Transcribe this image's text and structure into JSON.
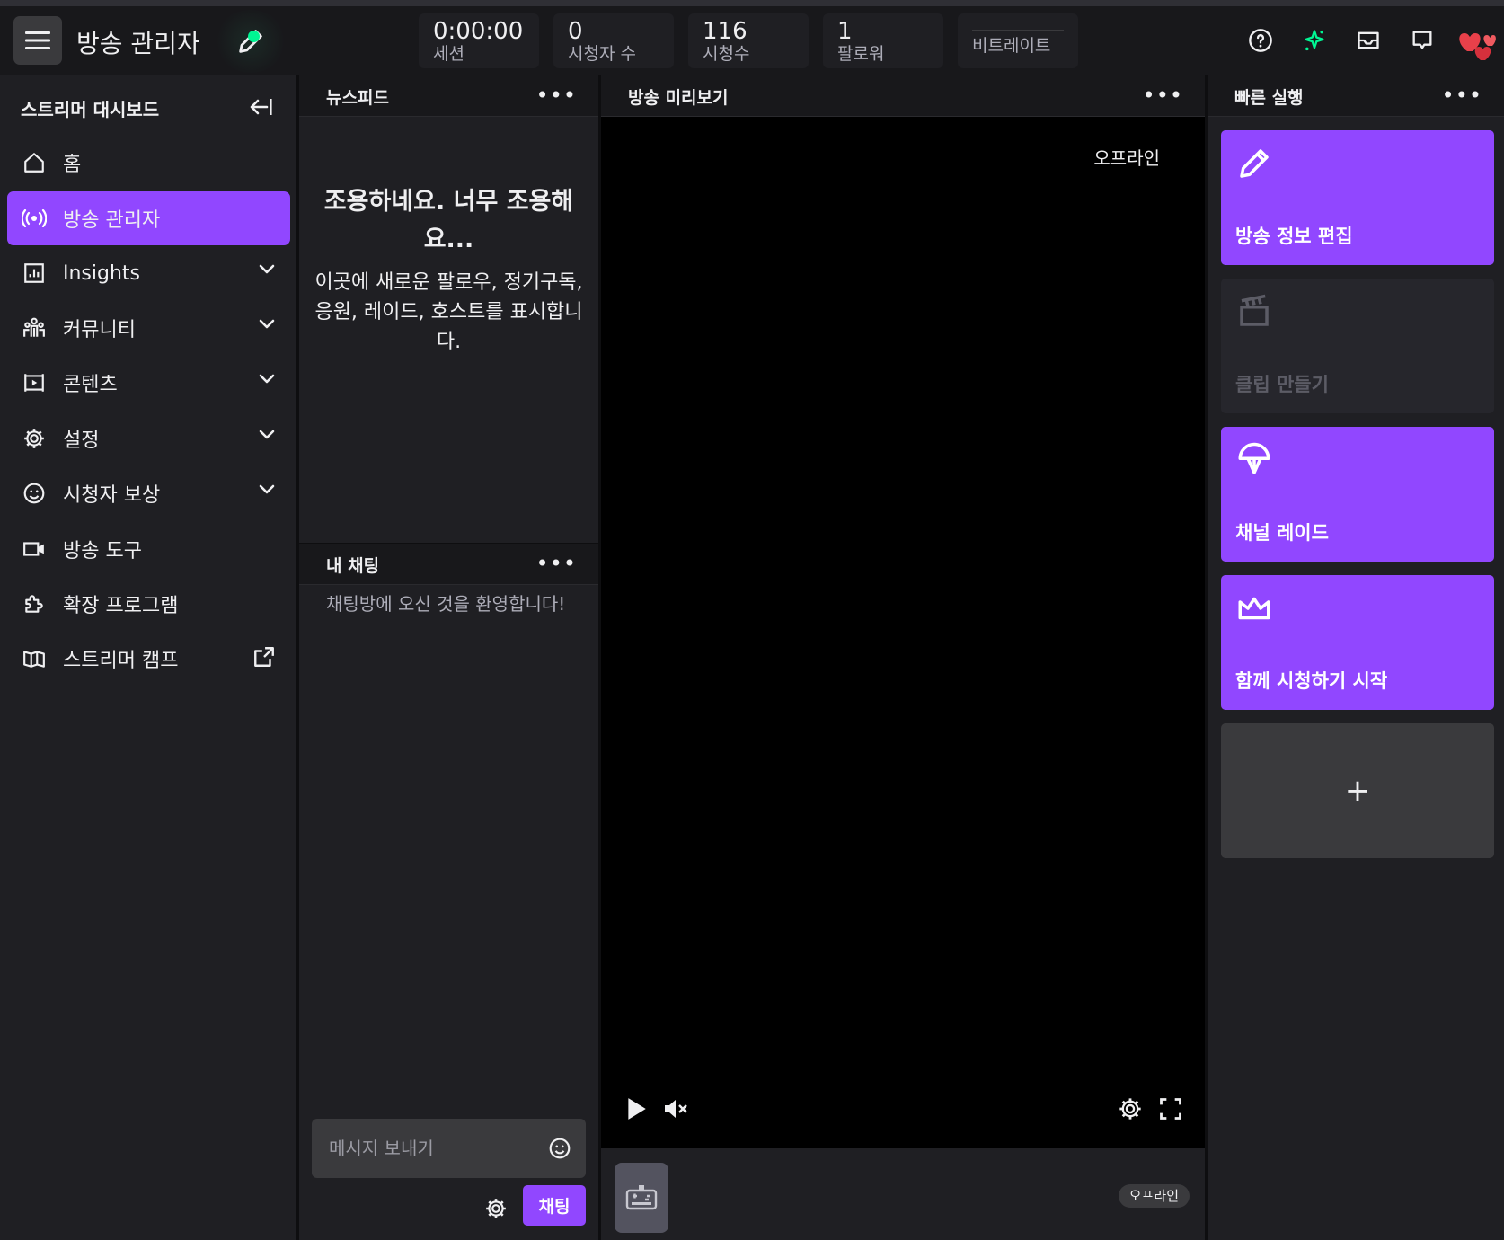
{
  "colors": {
    "accent": "#9147ff",
    "live": "#00f593",
    "bg": "#0e0e10",
    "panel": "#1f1f23"
  },
  "header": {
    "title": "방송 관리자",
    "stats": [
      {
        "value": "0:00:00",
        "label": "세션"
      },
      {
        "value": "0",
        "label": "시청자 수"
      },
      {
        "value": "116",
        "label": "시청수"
      },
      {
        "value": "1",
        "label": "팔로워"
      },
      {
        "value": "",
        "label": "비트레이트"
      }
    ],
    "icons": [
      "help-icon",
      "sparkle-icon",
      "inbox-icon",
      "whispers-icon",
      "avatar"
    ]
  },
  "sidebar": {
    "title": "스트리머 대시보드",
    "items": [
      {
        "label": "홈",
        "icon": "home-icon"
      },
      {
        "label": "방송 관리자",
        "icon": "broadcast-icon",
        "active": true
      },
      {
        "label": "Insights",
        "icon": "insights-icon"
      },
      {
        "label": "커뮤니티",
        "icon": "community-icon"
      },
      {
        "label": "콘텐츠",
        "icon": "content-icon"
      },
      {
        "label": "설정",
        "icon": "gear-icon"
      },
      {
        "label": "시청자 보상",
        "icon": "rewards-icon"
      },
      {
        "label": "방송 도구",
        "icon": "camera-icon"
      },
      {
        "label": "확장 프로그램",
        "icon": "puzzle-icon"
      },
      {
        "label": "스트리머 캠프",
        "icon": "book-icon"
      }
    ]
  },
  "newsfeed": {
    "title": "뉴스피드",
    "empty_title": "조용하네요. 너무 조용해요...",
    "empty_desc": "이곳에 새로운 팔로우, 정기구독, 응원, 레이드, 호스트를 표시합니다."
  },
  "chat": {
    "title": "내 채팅",
    "welcome": "채팅방에 오신 것을 환영합니다!",
    "placeholder": "메시지 보내기",
    "send_label": "채팅"
  },
  "preview": {
    "title": "방송 미리보기",
    "offline": "오프라인",
    "badge": "오프라인"
  },
  "quick_actions": {
    "title": "빠른 실행",
    "items": [
      {
        "label": "방송 정보 편집",
        "icon": "pencil-icon",
        "enabled": true
      },
      {
        "label": "클립 만들기",
        "icon": "clapper-icon",
        "enabled": false
      },
      {
        "label": "채널 레이드",
        "icon": "raid-icon",
        "enabled": true
      },
      {
        "label": "함께 시청하기 시작",
        "icon": "crown-icon",
        "enabled": true
      }
    ],
    "add_label": "+"
  },
  "menu_dots": "•••"
}
